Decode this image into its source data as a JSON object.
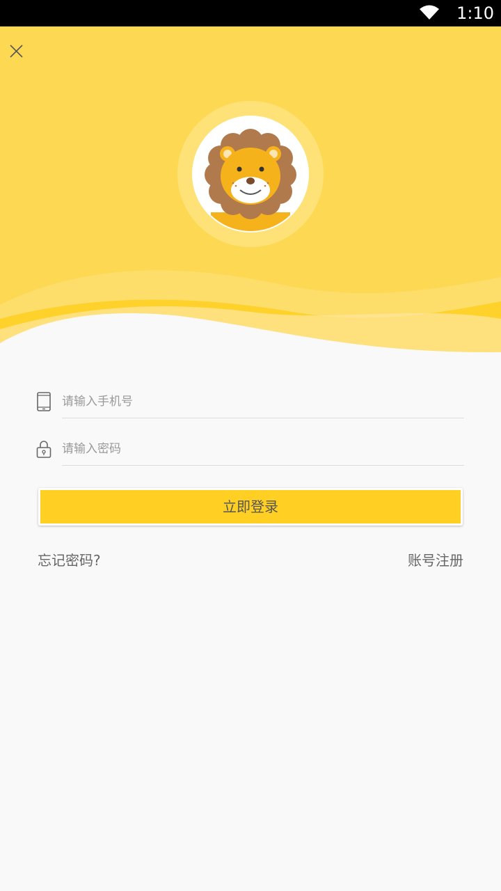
{
  "status_bar": {
    "time": "1:10"
  },
  "header": {
    "close_icon": "close-icon",
    "avatar": "lion-mascot"
  },
  "form": {
    "phone": {
      "placeholder": "请输入手机号",
      "value": "",
      "icon": "phone-icon"
    },
    "password": {
      "placeholder": "请输入密码",
      "value": "",
      "icon": "lock-icon"
    },
    "login_label": "立即登录"
  },
  "links": {
    "forgot_password": "忘记密码?",
    "register": "账号注册"
  },
  "colors": {
    "brand_yellow": "#ffcf23",
    "header_yellow": "#fdd74f",
    "background": "#f9f9f9"
  }
}
